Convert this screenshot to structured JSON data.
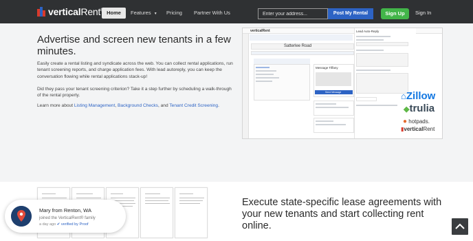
{
  "nav": {
    "logo_text_bold": "vertical",
    "logo_text": "Rent",
    "logo_reg": "®",
    "home": "Home",
    "features": "Features",
    "pricing": "Pricing",
    "partner": "Partner With Us",
    "search_placeholder": "Enter your address...",
    "post_button": "Post My Rental",
    "signup": "Sign Up",
    "signin": "Sign In"
  },
  "hero": {
    "headline": "Advertise and screen new tenants in a few minutes.",
    "para1": "Easily create a rental listing and syndicate across the web. You can collect rental applications, run tenant screening reports, and charge application fees. With lead autoreply, you can keep the conversation flowing while rental applications stack-up!",
    "para2": "Did they pass your tenant screening criterion? Take it a step further by scheduling a walk-through of the rental property.",
    "para3_prefix": "Learn more about ",
    "link_listing": "Listing Management",
    "sep1": ", ",
    "link_background": "Background Checks",
    "sep2": ", and ",
    "link_credit": "Tenant Credit Screening",
    "para3_suffix": "."
  },
  "mock": {
    "address": "Satterlee Road",
    "conversation": "Message Tiffany",
    "send": "Send Message",
    "lead": "Lead Auto-Reply"
  },
  "partners": {
    "zillow": "Zillow",
    "trulia": "trulia",
    "hotpads": "hotpads.",
    "vr_bold": "vertical",
    "vr": "Rent"
  },
  "lower": {
    "headline": "Execute state-specific lease agreements with your new tenants and start collecting rent online."
  },
  "toast": {
    "name": "Mary from Renton, WA",
    "sub": "joined the VerticalRent® family",
    "time": "a day ago",
    "verified": "verified by Proof"
  },
  "colors": {
    "nav_bg": "#2f3133",
    "accent_blue": "#2d63c4",
    "signup_green": "#42b549",
    "hero_bg": "#f3f4f5"
  }
}
